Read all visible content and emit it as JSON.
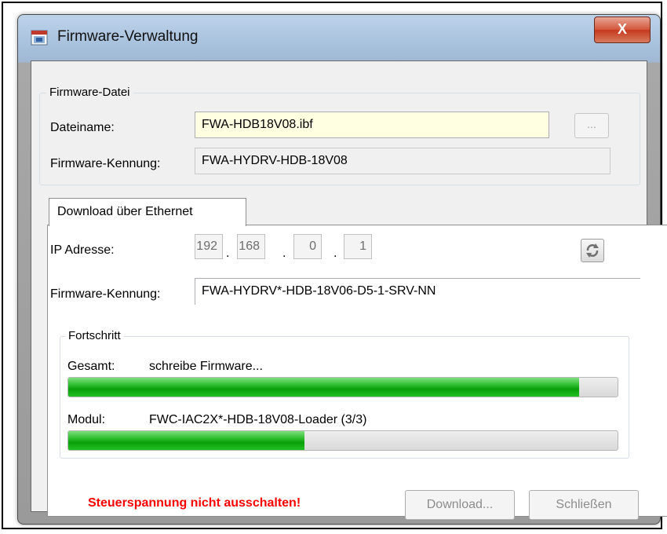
{
  "window": {
    "title": "Firmware-Verwaltung",
    "close_glyph": "X"
  },
  "firmware_file": {
    "group_title": "Firmware-Datei",
    "filename_label": "Dateiname:",
    "filename_value": "FWA-HDB18V08.ibf",
    "browse_label": "...",
    "id_label": "Firmware-Kennung:",
    "id_value": "FWA-HYDRV-HDB-18V08"
  },
  "tab": {
    "label": "Download über Ethernet"
  },
  "ethernet": {
    "ip_label": "IP Adresse:",
    "ip_octets": [
      "192",
      "168",
      "0",
      "1"
    ],
    "id_label": "Firmware-Kennung:",
    "id_value": "FWA-HYDRV*-HDB-18V06-D5-1-SRV-NN"
  },
  "progress": {
    "group_title": "Fortschritt",
    "total_label": "Gesamt:",
    "total_status": "schreibe Firmware...",
    "total_fraction": 0.93,
    "module_label": "Modul:",
    "module_status": "FWC-IAC2X*-HDB-18V08-Loader (3/3)",
    "module_fraction": 0.43
  },
  "footer": {
    "warning": "Steuerspannung nicht ausschalten!",
    "download_label": "Download...",
    "close_label": "Schließen"
  },
  "colors": {
    "warning": "#ff0000",
    "progress": "#22b922",
    "filename_bg": "#ffffe1"
  }
}
